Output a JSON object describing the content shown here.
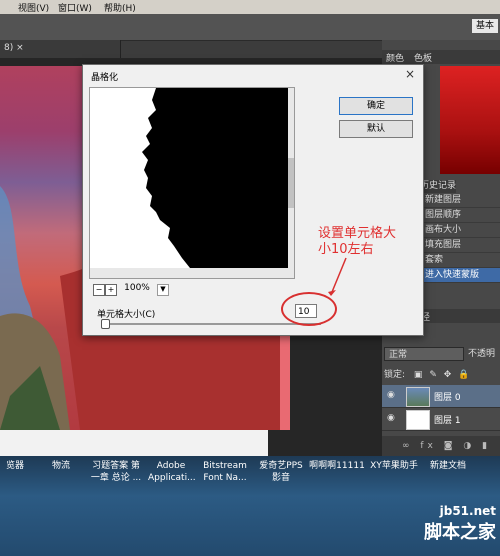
{
  "menu": {
    "items": [
      "视图(V)",
      "窗口(W)",
      "帮助(H)"
    ]
  },
  "options_bar": {
    "workspace": "基本"
  },
  "document_tab": {
    "label": "8) ×"
  },
  "color_panel": {
    "tabs": [
      "颜色",
      "色板"
    ]
  },
  "history_panel": {
    "tab": "历史记录",
    "items": [
      "新建图层",
      "图层顺序",
      "画布大小",
      "填充图层",
      "套索",
      "进入快速蒙版"
    ]
  },
  "layers_panel": {
    "tabs": [
      "通道",
      "路径"
    ],
    "blend_mode": "正常",
    "opacity_label": "不透明",
    "lock_label": "锁定:",
    "layers": [
      {
        "name": "图层 0"
      },
      {
        "name": "图层 1"
      }
    ],
    "bottom_icons": "fx"
  },
  "dialog": {
    "title": "晶格化",
    "ok": "确定",
    "default": "默认",
    "zoom": "100%",
    "zoom_out": "−",
    "zoom_in": "+",
    "cell_size_label": "单元格大小(C)",
    "cell_size_value": "10",
    "close": "×"
  },
  "annotation": {
    "text": "设置单元格大小10左右"
  },
  "taskbar": {
    "items": [
      "览器",
      "物流",
      "习题答案 第一章 总论 ...",
      "Adobe Applicati...",
      "Bitstream Font Na...",
      "爱奇艺PPS 影音",
      "啊啊啊11111",
      "XY苹果助手",
      "新建文档"
    ]
  },
  "watermark": {
    "url": "jb51.net",
    "brand": "脚本之家"
  },
  "colors": {
    "accent_red": "#e03030",
    "selected": "#3e6aa6"
  }
}
